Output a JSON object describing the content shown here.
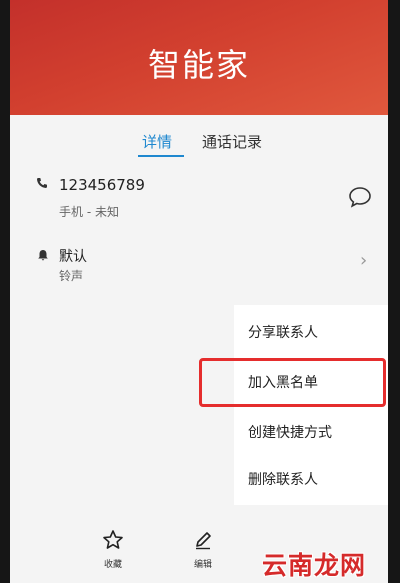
{
  "contact": {
    "name": "智能家"
  },
  "tabs": [
    {
      "label": "详情",
      "active": true
    },
    {
      "label": "通话记录",
      "active": false
    }
  ],
  "phone": {
    "number": "123456789",
    "type": "手机 - 未知"
  },
  "ringtone": {
    "value": "默认",
    "label": "铃声"
  },
  "menu": {
    "items": [
      {
        "label": "分享联系人"
      },
      {
        "label": "加入黑名单",
        "highlighted": true
      },
      {
        "label": "创建快捷方式"
      },
      {
        "label": "删除联系人"
      }
    ]
  },
  "bottom_bar": {
    "favorite_label": "收藏",
    "edit_label": "编辑"
  },
  "watermark": "云南龙网",
  "colors": {
    "header": "#d2402f",
    "accent": "#1f88cf",
    "highlight": "#e52d2d"
  },
  "icons": [
    "phone-icon",
    "message-icon",
    "bell-icon",
    "chevron-right-icon",
    "star-icon",
    "pencil-icon"
  ]
}
